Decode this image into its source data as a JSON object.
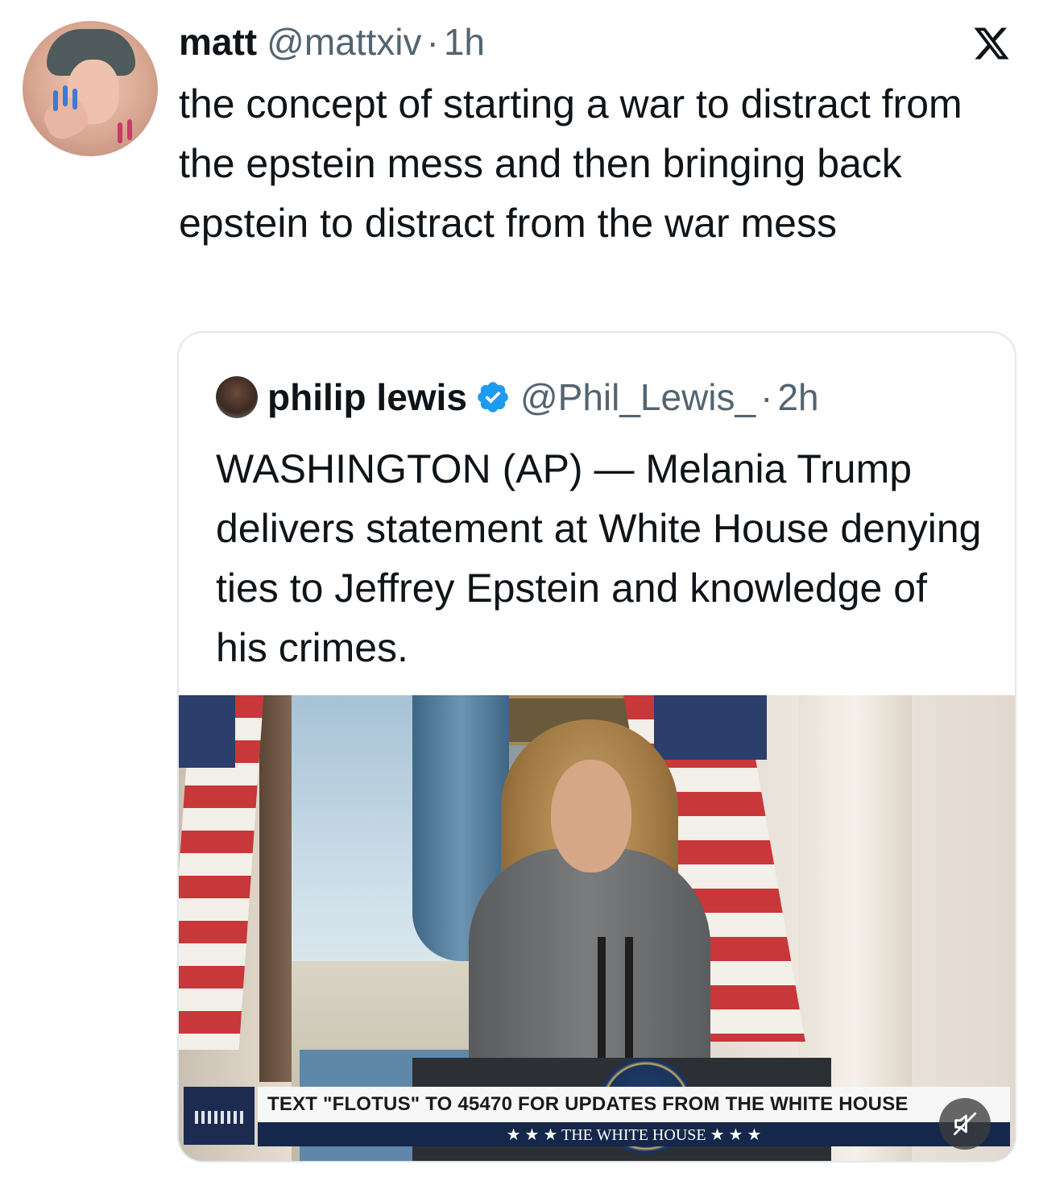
{
  "tweet": {
    "author_name": "matt",
    "author_handle": "@mattxiv",
    "separator": "·",
    "time": "1h",
    "text": "the concept of starting a war to distract from the epstein mess and then bringing back epstein to distract from the war mess"
  },
  "quote": {
    "author_name": "philip lewis",
    "author_handle": "@Phil_Lewis_",
    "separator": "·",
    "time": "2h",
    "verified": true,
    "text": "WASHINGTON (AP) — Melania Trump delivers statement at White House denying ties to Jeffrey Epstein and knowledge of his crimes."
  },
  "media": {
    "lower_third_text": "TEXT \"FLOTUS\" TO 45470 FOR UPDATES FROM THE WHITE HOUSE",
    "lower_third_sub": "★ ★ ★  THE WHITE HOUSE  ★ ★ ★"
  },
  "icons": {
    "x_logo": "x-logo-icon",
    "verified": "verified-badge-icon",
    "mute": "sound-off-icon"
  },
  "colors": {
    "text": "#0f1419",
    "secondary": "#536471",
    "verified": "#1d9bf0",
    "border": "#e1e8ed"
  }
}
